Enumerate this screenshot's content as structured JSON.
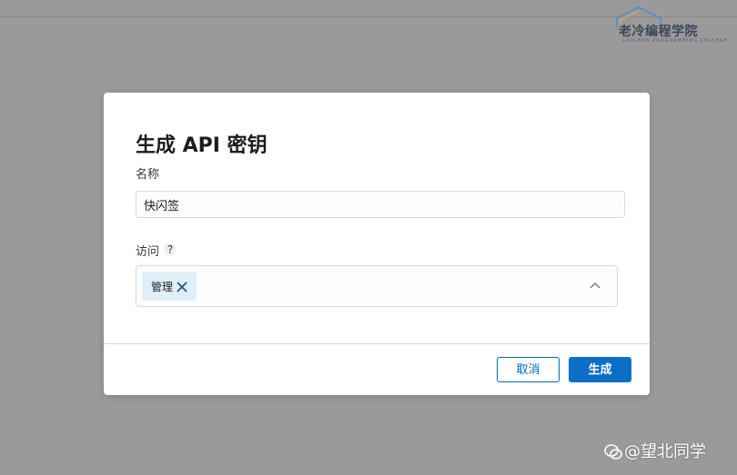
{
  "watermark": {
    "logo_cn": "老冷编程学院",
    "logo_en": "LAOLENG PROGRAMMING COLLEGE"
  },
  "modal": {
    "title": "生成 API 密钥",
    "name_label": "名称",
    "name_value": "快闪签",
    "access_label": "访问",
    "help_symbol": "?",
    "access_selected": [
      "管理"
    ],
    "cancel_label": "取消",
    "generate_label": "生成"
  },
  "credit": {
    "text": "@望北同学"
  },
  "colors": {
    "primary": "#0b6fc7",
    "chip_bg": "#e0eef7",
    "overlay": "#9a9a9a"
  }
}
